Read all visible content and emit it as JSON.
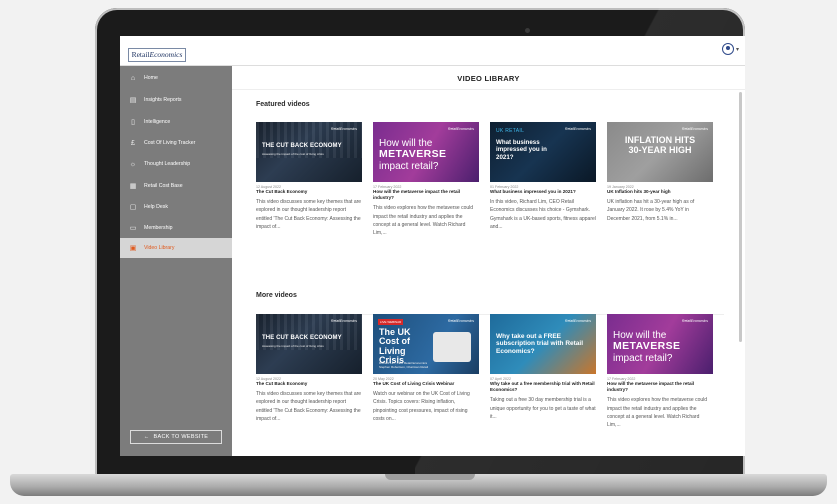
{
  "app": {
    "logo_part1": "Retail",
    "logo_part2": "Economics"
  },
  "sidebar": {
    "items": [
      {
        "label": "Home",
        "icon": "home-icon",
        "glyph": "⌂"
      },
      {
        "label": "Insights Reports",
        "icon": "document-icon",
        "glyph": "▤"
      },
      {
        "label": "Intelligence",
        "icon": "file-icon",
        "glyph": "▯"
      },
      {
        "label": "Cost Of Living Tracker",
        "icon": "pound-icon",
        "glyph": "£"
      },
      {
        "label": "Thought Leadership",
        "icon": "lightbulb-icon",
        "glyph": "☼"
      },
      {
        "label": "Retail Cost Base",
        "icon": "calculator-icon",
        "glyph": "▦"
      },
      {
        "label": "Help Desk",
        "icon": "help-icon",
        "glyph": "▢"
      },
      {
        "label": "Membership",
        "icon": "card-icon",
        "glyph": "▭"
      },
      {
        "label": "Video Library",
        "icon": "video-icon",
        "glyph": "▣"
      }
    ],
    "active_index": 8,
    "back_button": "BACK TO WEBSITE",
    "back_arrow": "←"
  },
  "user": {
    "icon": "user-circle-icon",
    "chevron": "▾"
  },
  "main": {
    "title": "VIDEO LIBRARY",
    "featured_heading": "Featured videos",
    "more_heading": "More videos",
    "featured": [
      {
        "date": "12 August 2022",
        "title": "The Cut Back Economy",
        "desc": "This video discusses some key themes that are explored in our thought leadership report entitled 'The Cut Back Economy: Assessing the impact of...",
        "thumb_text": "THE CUT BACK ECONOMY",
        "thumb_sub": "Assessing the impact of the cost of living crisis",
        "brand": "RetailEconomics"
      },
      {
        "date": "17 February 2022",
        "title": "How will the metaverse impact the retail industry?",
        "desc": "This video explores how the metaverse could impact the retail industry and applies the concept at a general level. Watch Richard Lim,...",
        "thumb_line1": "How will the",
        "thumb_line2": "METAVERSE",
        "thumb_line3": "impact retail?",
        "brand": "RetailEconomics"
      },
      {
        "date": "01 February 2022",
        "title": "What business impressed you in 2021?",
        "desc": "In this video, Richard Lim, CEO Retail Economics discusses his choice - Gymshark. Gymshark is a UK-based sports, fitness apparel and...",
        "thumb_kicker": "UK RETAIL",
        "thumb_text": "What business impressed you in 2021?",
        "brand": "RetailEconomics"
      },
      {
        "date": "19 January 2022",
        "title": "UK Inflation hits 30-year high",
        "desc": "UK inflation has hit a 30-year high as of January 2022. It rose by 5.4% YoY in December 2021, from 5.1% in...",
        "thumb_line1": "INFLATION HITS",
        "thumb_line2": "30-YEAR HIGH",
        "brand": "RetailEconomics"
      }
    ],
    "more": [
      {
        "date": "12 August 2022",
        "title": "The Cut Back Economy",
        "desc": "This video discusses some key themes that are explored in our thought leadership report entitled 'The Cut Back Economy: Assessing the impact of...",
        "thumb_text": "THE CUT BACK ECONOMY",
        "thumb_sub": "Assessing the impact of the cost of living crisis",
        "brand": "RetailEconomics"
      },
      {
        "date": "20 May 2022",
        "title": "The UK Cost of Living Crisis Webinar",
        "desc": "Watch our webinar on the UK Cost of Living Crisis. Topics covers: Rising inflation, pinpointing cost pressures, impact of rising costs on...",
        "thumb_tag": "LIVE WEBINAR",
        "thumb_text": "The UK Cost of Living Crisis",
        "thumb_sub": "Richard Lim, CEO Retail Economics Stephen Robertson, Chairman Retail",
        "brand": "RetailEconomics"
      },
      {
        "date": "07 April 2022",
        "title": "Why take out a free membership trial with Retail Economics?",
        "desc": "Taking out a free 30 day membership trial is a unique opportunity for you to get a taste of what it...",
        "thumb_text": "Why take out a FREE subscription trial with Retail Economics?",
        "brand": "RetailEconomics"
      },
      {
        "date": "17 February 2022",
        "title": "How will the metaverse impact the retail industry?",
        "desc": "This video explores how the metaverse could impact the retail industry and applies the concept at a general level. Watch Richard Lim,...",
        "thumb_line1": "How will the",
        "thumb_line2": "METAVERSE",
        "thumb_line3": "impact retail?",
        "brand": "RetailEconomics"
      }
    ]
  },
  "colors": {
    "sidebar_bg": "#7c7c7c",
    "active_accent": "#e05a1e",
    "brand_navy": "#1f3462"
  }
}
